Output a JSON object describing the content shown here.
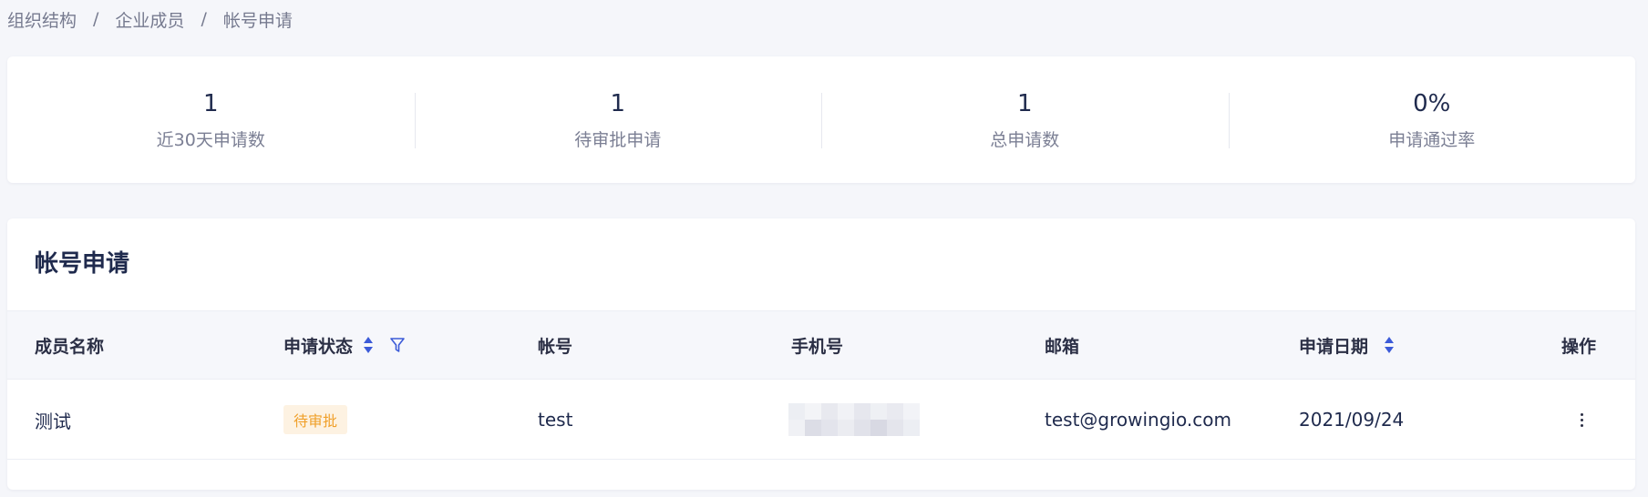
{
  "breadcrumb": {
    "items": [
      "组织结构",
      "企业成员",
      "帐号申请"
    ],
    "separator": "/"
  },
  "stats": [
    {
      "value": "1",
      "label": "近30天申请数"
    },
    {
      "value": "1",
      "label": "待审批申请"
    },
    {
      "value": "1",
      "label": "总申请数"
    },
    {
      "value": "0%",
      "label": "申请通过率"
    }
  ],
  "table": {
    "title": "帐号申请",
    "columns": {
      "name": "成员名称",
      "status": "申请状态",
      "account": "帐号",
      "phone": "手机号",
      "email": "邮箱",
      "date": "申请日期",
      "action": "操作"
    },
    "rows": [
      {
        "name": "测试",
        "status": "待审批",
        "account": "test",
        "phone_masked": true,
        "email": "test@growingio.com",
        "date": "2021/09/24"
      }
    ]
  },
  "colors": {
    "accent": "#3c5bd8",
    "pending_text": "#f0a02a",
    "pending_bg": "#fdf2e2"
  },
  "icons": {
    "status_sort": "sort-icon",
    "status_filter": "filter-icon",
    "date_sort": "sort-icon",
    "row_action": "more-vertical-icon"
  }
}
